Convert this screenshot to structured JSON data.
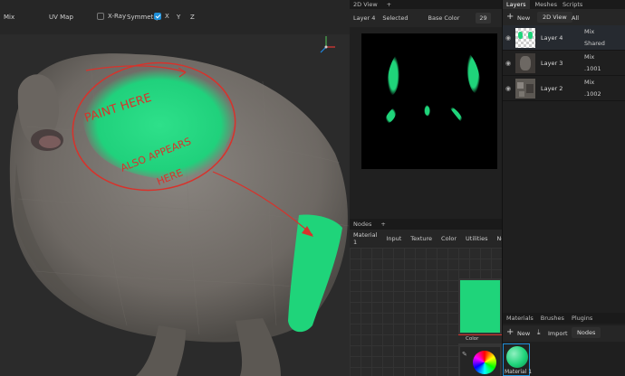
{
  "viewport_toolbar": {
    "blend_mode": "Mix",
    "uv_map": "UV Map",
    "xray_label": "X-Ray",
    "symmetry_label": "Symmetry",
    "axis_x": "X",
    "axis_y": "Y",
    "axis_z": "Z"
  },
  "annotations": {
    "paint_here": "PAINT HERE",
    "also_appears": "ALSO APPEARS",
    "here": "HERE"
  },
  "panel_2d": {
    "tab": "2D View",
    "add": "+",
    "layer": "Layer 4",
    "selected": "Selected",
    "channel": "Base Color",
    "size": "29"
  },
  "panel_nodes": {
    "tab": "Nodes",
    "add": "+",
    "menu": [
      "Material 1",
      "Input",
      "Texture",
      "Color",
      "Utilities",
      "Neu"
    ],
    "node_label": "Color",
    "node_color": "#1fd47a"
  },
  "panel_layers": {
    "tabs": [
      "Layers",
      "Meshes",
      "Scripts"
    ],
    "new_label": "New",
    "view_2d": "2D View",
    "all_label": "All",
    "layers": [
      {
        "name": "Layer 4",
        "blend": "Mix",
        "opacity": "Shared"
      },
      {
        "name": "Layer 3",
        "blend": "Mix",
        "opacity": ".1001"
      },
      {
        "name": "Layer 2",
        "blend": "Mix",
        "opacity": ".1002"
      }
    ]
  },
  "panel_materials": {
    "tabs": [
      "Materials",
      "Brushes",
      "Plugins"
    ],
    "new_label": "New",
    "import_label": "Import",
    "nodes_label": "Nodes",
    "material_name": "Material 1"
  },
  "colors": {
    "paint_green": "#1fd47a",
    "annotation_red": "#d8322b",
    "accent_blue": "#1f8fd8"
  }
}
